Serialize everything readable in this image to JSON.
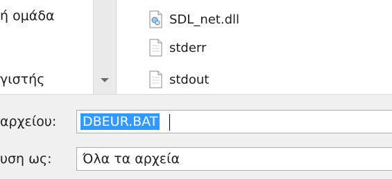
{
  "nav": {
    "items": [
      {
        "label": "ή ομάδα"
      },
      {
        "label": "γιστής"
      }
    ]
  },
  "files": [
    {
      "name": "SDL_net.dll",
      "icon": "dll-file-icon"
    },
    {
      "name": "stderr",
      "icon": "text-file-icon"
    },
    {
      "name": "stdout",
      "icon": "text-file-icon"
    }
  ],
  "bottom": {
    "filename_label": "αρχείου:",
    "filename_value": "DBEUR.BAT",
    "type_label": "υση ως:",
    "type_value": "Όλα τα αρχεία"
  }
}
